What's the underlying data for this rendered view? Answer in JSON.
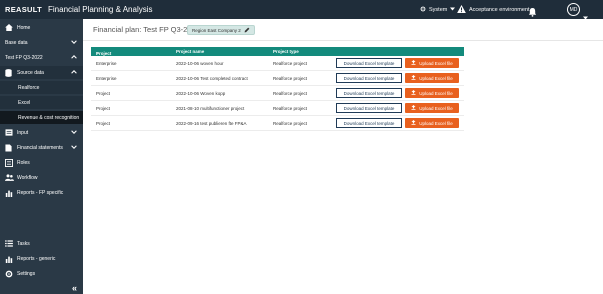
{
  "topbar": {
    "brand": "REASULT",
    "title": "Financial Planning & Analysis",
    "system_label": "System",
    "environment_label": "Acceptance environment",
    "avatar_initials": "MD"
  },
  "sidebar": {
    "items": [
      {
        "label": "Home"
      },
      {
        "label": "Base data"
      },
      {
        "label": "Test FP Q3-2022"
      },
      {
        "label": "Source data"
      },
      {
        "label": "Realforce"
      },
      {
        "label": "Excel"
      },
      {
        "label": "Revenue & cost recognition"
      },
      {
        "label": "Input"
      },
      {
        "label": "Financial statements"
      },
      {
        "label": "Roles"
      },
      {
        "label": "Workflow"
      },
      {
        "label": "Reports - FP specific"
      },
      {
        "label": "Tasks"
      },
      {
        "label": "Reports - generic"
      },
      {
        "label": "Settings"
      }
    ]
  },
  "main": {
    "breadcrumb": "Financial plan: Test FP Q3-2022",
    "company_chip": "Region East Company 2",
    "table": {
      "headers": [
        "Project configuration",
        "Project name",
        "Project type"
      ],
      "rows": [
        {
          "config": "Enterprise",
          "name": "2022-10-06 woven hour",
          "type": "Realforce project"
        },
        {
          "config": "Enterprise",
          "name": "2022-10-06 Test completed contract",
          "type": "Realforce project"
        },
        {
          "config": "Project",
          "name": "2022-10-06 Woven kopp",
          "type": "Realforce project"
        },
        {
          "config": "Project",
          "name": "2021-08-10 multifunctioner project",
          "type": "Realforce project"
        },
        {
          "config": "Project",
          "name": "2022-09-16 test publieren fte FP&A",
          "type": "Realforce project"
        }
      ],
      "download_label": "Download Excel template",
      "upload_label": "Upload Excel file"
    }
  },
  "colors": {
    "topbar": "#1f2d3a",
    "sidebar": "#2a3946",
    "table_header": "#138a7c",
    "upload_button": "#e8601e"
  }
}
